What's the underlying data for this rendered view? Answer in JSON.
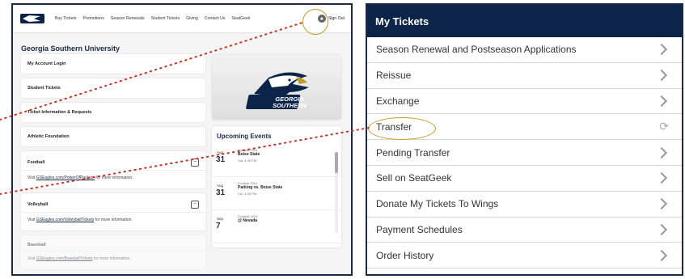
{
  "nav": {
    "items": [
      "Buy Tickets",
      "Promotions",
      "Season Renewals",
      "Student Tickets",
      "Giving",
      "Contact Us",
      "SeatGeek"
    ],
    "signout": "Sign Out"
  },
  "org_title": "Georgia Southern University",
  "cards": {
    "login": "My Account Login",
    "student": "Student Tickets",
    "info": "Ticket Information & Requests",
    "foundation": "Athletic Foundation",
    "football": {
      "title": "Football",
      "pre": "Visit",
      "link": "GSEagles.com/PowerOfPaulson",
      "post": "for more information."
    },
    "volleyball": {
      "title": "Volleyball",
      "pre": "Visit",
      "link": "GSEagles.com/VolleyballTickets",
      "post": "for more information."
    },
    "baseball": {
      "title": "Baseball",
      "pre": "Visit",
      "link": "GSEagles.com/BaseballTickets",
      "post": "for more information."
    }
  },
  "hero": {
    "logo_line1": "GEORGIA",
    "logo_line2": "SOUTHERN"
  },
  "events": {
    "title": "Upcoming Events",
    "items": [
      {
        "month": "Aug",
        "day": "31",
        "category": "Football 2024",
        "name": "Boise State",
        "time": "Sat, 4:30 PM"
      },
      {
        "month": "Aug",
        "day": "31",
        "category": "Football 2024",
        "name": "Parking vs. Boise State",
        "time": "Sat, 4:30 PM"
      },
      {
        "month": "Sep",
        "day": "7",
        "category": "Football 2024",
        "name": "@ Nevada",
        "time": ""
      }
    ]
  },
  "my_tickets": {
    "title": "My Tickets",
    "items": [
      "Season Renewal and Postseason Applications",
      "Reissue",
      "Exchange",
      "Transfer",
      "Pending Transfer",
      "Sell on SeatGeek",
      "Donate My Tickets To Wings",
      "Payment Schedules",
      "Order History"
    ]
  },
  "colors": {
    "navy": "#0b2447",
    "highlight": "#c49a29",
    "dotted_line": "#c0392b"
  }
}
